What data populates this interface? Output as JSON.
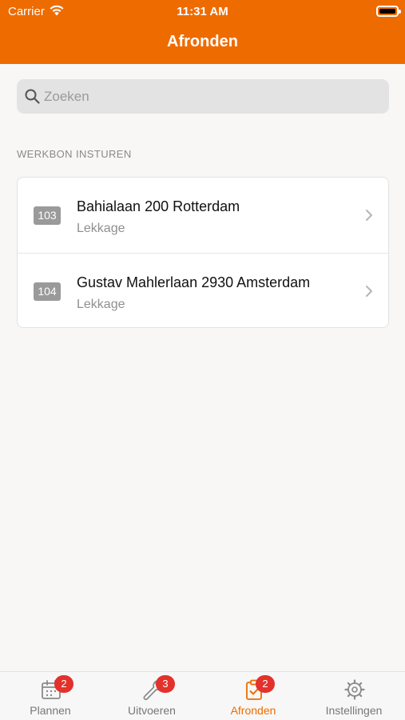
{
  "status_bar": {
    "carrier": "Carrier",
    "time": "11:31 AM"
  },
  "header": {
    "title": "Afronden",
    "accent_color": "#ee6b00"
  },
  "search": {
    "placeholder": "Zoeken",
    "value": ""
  },
  "section": {
    "title": "WERKBON INSTUREN"
  },
  "items": [
    {
      "number": "103",
      "address": "Bahialaan 200 Rotterdam",
      "type": "Lekkage"
    },
    {
      "number": "104",
      "address": "Gustav Mahlerlaan 2930 Amsterdam",
      "type": "Lekkage"
    }
  ],
  "tabbar": {
    "tabs": [
      {
        "label": "Plannen",
        "icon": "calendar-icon",
        "badge": "2",
        "active": false
      },
      {
        "label": "Uitvoeren",
        "icon": "wrench-icon",
        "badge": "3",
        "active": false
      },
      {
        "label": "Afronden",
        "icon": "clipboard-check-icon",
        "badge": "2",
        "active": true
      },
      {
        "label": "Instellingen",
        "icon": "gear-icon",
        "badge": "",
        "active": false
      }
    ],
    "badge_color": "#e3312b"
  }
}
